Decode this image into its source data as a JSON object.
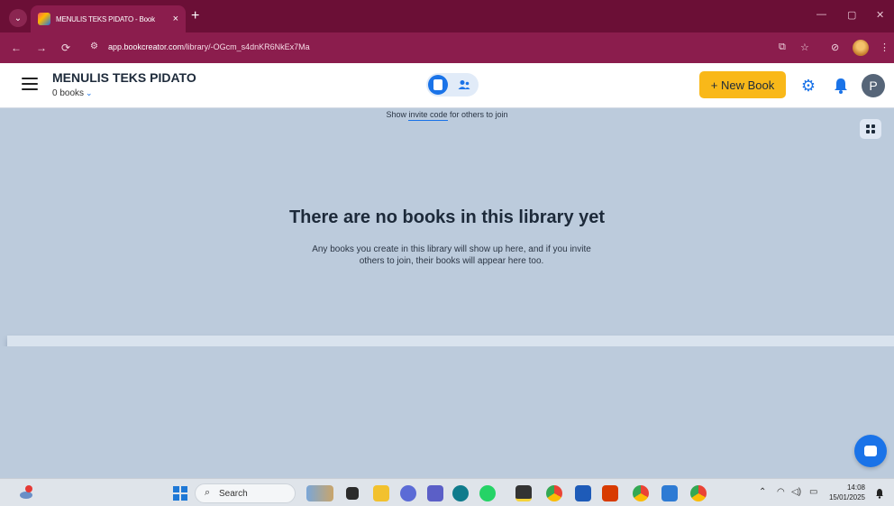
{
  "browser": {
    "tab_title": "MENULIS TEKS PIDATO - Book",
    "url_host": "app.bookcreator.com",
    "url_path": "/library/-OGcm_s4dnKR6NkEx7Ma",
    "tab_close": "×",
    "new_tab": "+",
    "nav_back": "←",
    "nav_forward": "→",
    "nav_reload": "⟳",
    "win_minimize": "—",
    "win_maximize": "▢",
    "win_close": "✕"
  },
  "header": {
    "library_title": "MENULIS TEKS PIDATO",
    "book_count": "0 books",
    "new_book_label": "+ New Book",
    "avatar_initial": "P"
  },
  "main": {
    "invite_prefix": "Show ",
    "invite_link": "invite code",
    "invite_suffix": " for others to join",
    "empty_heading": "There are no books in this library yet",
    "empty_description": "Any books you create in this library will show up here, and if you invite others to join, their books will appear here too."
  },
  "taskbar": {
    "search_placeholder": "Search",
    "time": "14:08",
    "date": "15/01/2025"
  },
  "colors": {
    "browser_frame": "#6b0f36",
    "accent_blue": "#1a73e8",
    "new_book_yellow": "#f9b819",
    "content_bg": "#bccbdc"
  }
}
